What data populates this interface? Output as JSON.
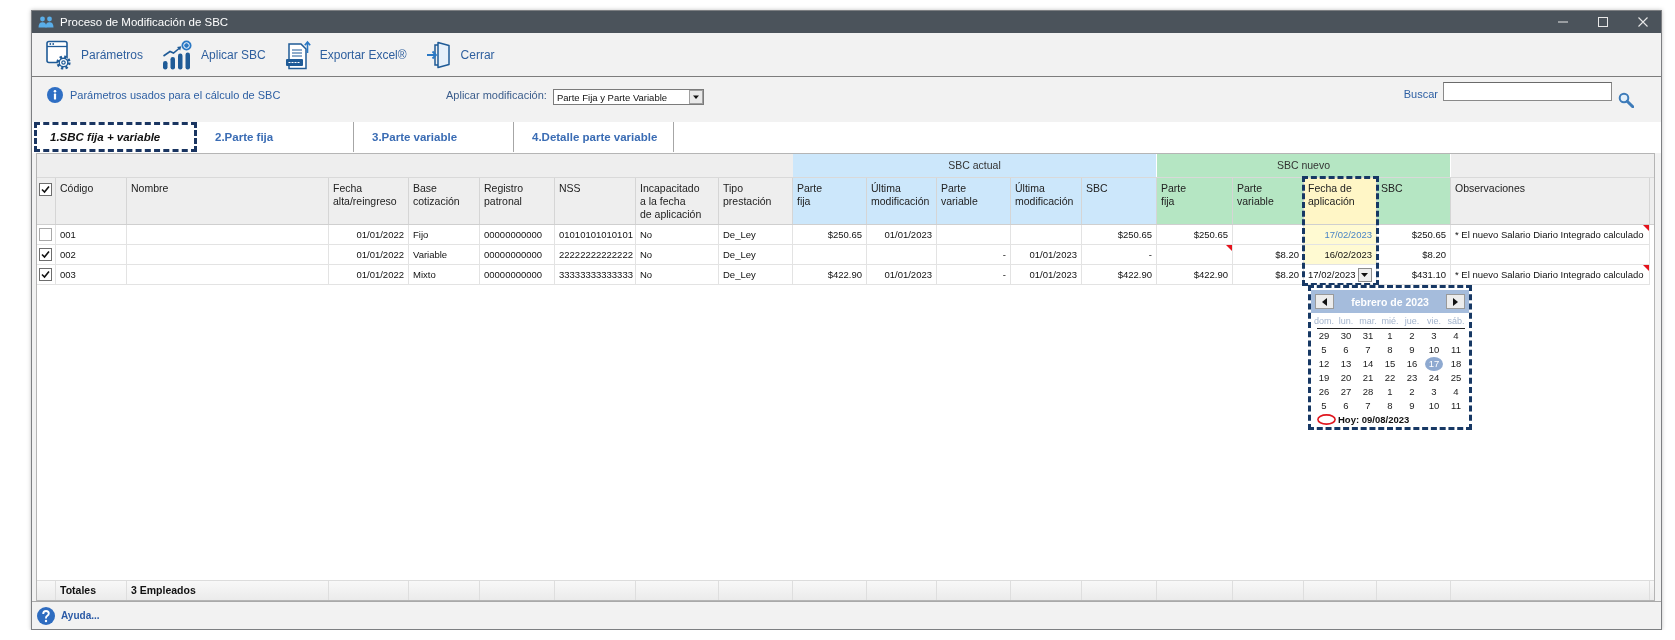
{
  "window": {
    "title": "Proceso de Modificación de SBC"
  },
  "toolbar": [
    {
      "label": "Parámetros",
      "kind": "parameters"
    },
    {
      "label": "Aplicar SBC",
      "kind": "apply"
    },
    {
      "label": "Exportar Excel®",
      "kind": "export"
    },
    {
      "label": "Cerrar",
      "kind": "close"
    }
  ],
  "options_bar": {
    "info_link": "Parámetros usados para el cálculo de SBC",
    "apply_modification": {
      "label": "Aplicar modificación:",
      "value": "Parte Fija y Parte Variable"
    },
    "search": {
      "label": "Buscar"
    }
  },
  "tabs": [
    {
      "label": "1.SBC fija + variable",
      "selected": true,
      "highlighted": true
    },
    {
      "label": "2.Parte fija",
      "selected": false,
      "highlighted": false
    },
    {
      "label": "3.Parte variable",
      "selected": false,
      "highlighted": false
    },
    {
      "label": "4.Detalle parte variable",
      "selected": false,
      "highlighted": false
    }
  ],
  "table": {
    "select_all": {
      "checked": true
    },
    "column_groups": [
      {
        "columns": [
          {
            "label": "Código",
            "kind": "text",
            "highlighted": false
          },
          {
            "label": "Nombre",
            "kind": "text",
            "highlighted": false
          },
          {
            "label": "Fecha\nalta/reingreso",
            "kind": "numeric",
            "highlighted": false
          },
          {
            "label": "Base\ncotización",
            "kind": "text",
            "highlighted": false
          },
          {
            "label": "Registro\npatronal",
            "kind": "text",
            "highlighted": false
          },
          {
            "label": "NSS",
            "kind": "text",
            "highlighted": false
          },
          {
            "label": "Incapacitado\na la fecha\nde aplicación",
            "kind": "text",
            "highlighted": false
          },
          {
            "label": "Tipo\nprestación",
            "kind": "text",
            "highlighted": false
          }
        ]
      },
      {
        "label": "SBC actual",
        "color": "#cce7fb",
        "columns": [
          {
            "label": "Parte\nfija",
            "kind": "numeric",
            "highlighted": false
          },
          {
            "label": "Última\nmodificación",
            "kind": "numeric",
            "highlighted": false
          },
          {
            "label": "Parte\nvariable",
            "kind": "numeric",
            "highlighted": false
          },
          {
            "label": "Última\nmodificación",
            "kind": "numeric",
            "highlighted": false
          },
          {
            "label": "SBC",
            "kind": "numeric",
            "highlighted": false
          }
        ]
      },
      {
        "label": "SBC nuevo",
        "color": "#b5e6c3",
        "columns": [
          {
            "label": "Parte\nfija",
            "kind": "numeric",
            "highlighted": false
          },
          {
            "label": "Parte\nvariable",
            "kind": "numeric",
            "highlighted": false
          },
          {
            "label": "Fecha de\naplicación",
            "kind": "input",
            "highlighted": true
          },
          {
            "label": "SBC",
            "kind": "numeric",
            "highlighted": false
          }
        ]
      },
      {
        "columns": [
          {
            "label": "Observaciones",
            "kind": "text",
            "highlighted": false
          }
        ]
      }
    ],
    "rows": [
      {
        "checked": false,
        "cells": [
          {
            "text": "001",
            "comment": false
          },
          {
            "comment": false
          },
          {
            "text": "01/01/2022",
            "comment": false
          },
          {
            "text": "Fijo",
            "comment": false
          },
          {
            "text": "00000000000",
            "comment": false
          },
          {
            "text": "01010101010101",
            "comment": false
          },
          {
            "text": "No",
            "comment": false
          },
          {
            "text": "De_Ley",
            "comment": false
          },
          {
            "text": "$250.65",
            "comment": false
          },
          {
            "text": "01/01/2023",
            "comment": false
          },
          {
            "comment": false
          },
          {
            "comment": false
          },
          {
            "text": "$250.65",
            "comment": false
          },
          {
            "text": "$250.65",
            "comment": false
          },
          {
            "comment": false
          },
          {
            "text": "17/02/2023",
            "comment": false,
            "auto": true,
            "editing": false
          },
          {
            "text": "$250.65",
            "comment": false
          },
          {
            "text": "* El nuevo Salario Diario Integrado calculado",
            "comment": true
          }
        ]
      },
      {
        "checked": true,
        "cells": [
          {
            "text": "002",
            "comment": false
          },
          {
            "comment": false
          },
          {
            "text": "01/01/2022",
            "comment": false
          },
          {
            "text": "Variable",
            "comment": false
          },
          {
            "text": "00000000000",
            "comment": false
          },
          {
            "text": "22222222222222",
            "comment": false
          },
          {
            "text": "No",
            "comment": false
          },
          {
            "text": "De_Ley",
            "comment": false
          },
          {
            "comment": false
          },
          {
            "comment": false
          },
          {
            "text": "-",
            "comment": false
          },
          {
            "text": "01/01/2023",
            "comment": false
          },
          {
            "text": "-",
            "comment": false
          },
          {
            "comment": true
          },
          {
            "text": "$8.20",
            "comment": false
          },
          {
            "text": "16/02/2023",
            "comment": false,
            "auto": false,
            "editing": false
          },
          {
            "text": "$8.20",
            "comment": false
          },
          {
            "comment": false
          }
        ]
      },
      {
        "checked": true,
        "cells": [
          {
            "text": "003",
            "comment": false
          },
          {
            "comment": false
          },
          {
            "text": "01/01/2022",
            "comment": false
          },
          {
            "text": "Mixto",
            "comment": false
          },
          {
            "text": "00000000000",
            "comment": false
          },
          {
            "text": "33333333333333",
            "comment": false
          },
          {
            "text": "No",
            "comment": false
          },
          {
            "text": "De_Ley",
            "comment": false
          },
          {
            "text": "$422.90",
            "comment": false
          },
          {
            "text": "01/01/2023",
            "comment": false
          },
          {
            "text": "-",
            "comment": false
          },
          {
            "text": "01/01/2023",
            "comment": false
          },
          {
            "text": "$422.90",
            "comment": false
          },
          {
            "text": "$422.90",
            "comment": false
          },
          {
            "text": "$8.20",
            "comment": false
          },
          {
            "text": "17/02/2023",
            "comment": false,
            "auto": false,
            "editing": true
          },
          {
            "text": "$431.10",
            "comment": false
          },
          {
            "text": "* El nuevo Salario Diario Integrado calculado",
            "comment": true
          }
        ]
      }
    ],
    "totals": {
      "label": "Totales",
      "count": "3 Empleados"
    }
  },
  "date_picker": {
    "title": "febrero de 2023",
    "highlighted": true,
    "weekdays": [
      "dom.",
      "lun.",
      "mar.",
      "mié.",
      "jue.",
      "vie.",
      "sáb."
    ],
    "weeks": [
      [
        {
          "day": "29",
          "selected": false
        },
        {
          "day": "30",
          "selected": false
        },
        {
          "day": "31",
          "selected": false
        },
        {
          "day": "1",
          "selected": false
        },
        {
          "day": "2",
          "selected": false
        },
        {
          "day": "3",
          "selected": false
        },
        {
          "day": "4",
          "selected": false
        }
      ],
      [
        {
          "day": "5",
          "selected": false
        },
        {
          "day": "6",
          "selected": false
        },
        {
          "day": "7",
          "selected": false
        },
        {
          "day": "8",
          "selected": false
        },
        {
          "day": "9",
          "selected": false
        },
        {
          "day": "10",
          "selected": false
        },
        {
          "day": "11",
          "selected": false
        }
      ],
      [
        {
          "day": "12",
          "selected": false
        },
        {
          "day": "13",
          "selected": false
        },
        {
          "day": "14",
          "selected": false
        },
        {
          "day": "15",
          "selected": false
        },
        {
          "day": "16",
          "selected": false
        },
        {
          "day": "17",
          "selected": true
        },
        {
          "day": "18",
          "selected": false
        }
      ],
      [
        {
          "day": "19",
          "selected": false
        },
        {
          "day": "20",
          "selected": false
        },
        {
          "day": "21",
          "selected": false
        },
        {
          "day": "22",
          "selected": false
        },
        {
          "day": "23",
          "selected": false
        },
        {
          "day": "24",
          "selected": false
        },
        {
          "day": "25",
          "selected": false
        }
      ],
      [
        {
          "day": "26",
          "selected": false
        },
        {
          "day": "27",
          "selected": false
        },
        {
          "day": "28",
          "selected": false
        },
        {
          "day": "1",
          "selected": false
        },
        {
          "day": "2",
          "selected": false
        },
        {
          "day": "3",
          "selected": false
        },
        {
          "day": "4",
          "selected": false
        }
      ],
      [
        {
          "day": "5",
          "selected": false
        },
        {
          "day": "6",
          "selected": false
        },
        {
          "day": "7",
          "selected": false
        },
        {
          "day": "8",
          "selected": false
        },
        {
          "day": "9",
          "selected": false
        },
        {
          "day": "10",
          "selected": false
        },
        {
          "day": "11",
          "selected": false
        }
      ]
    ],
    "today": "Hoy: 09/08/2023"
  },
  "status_bar": {
    "help": "Ayuda..."
  }
}
